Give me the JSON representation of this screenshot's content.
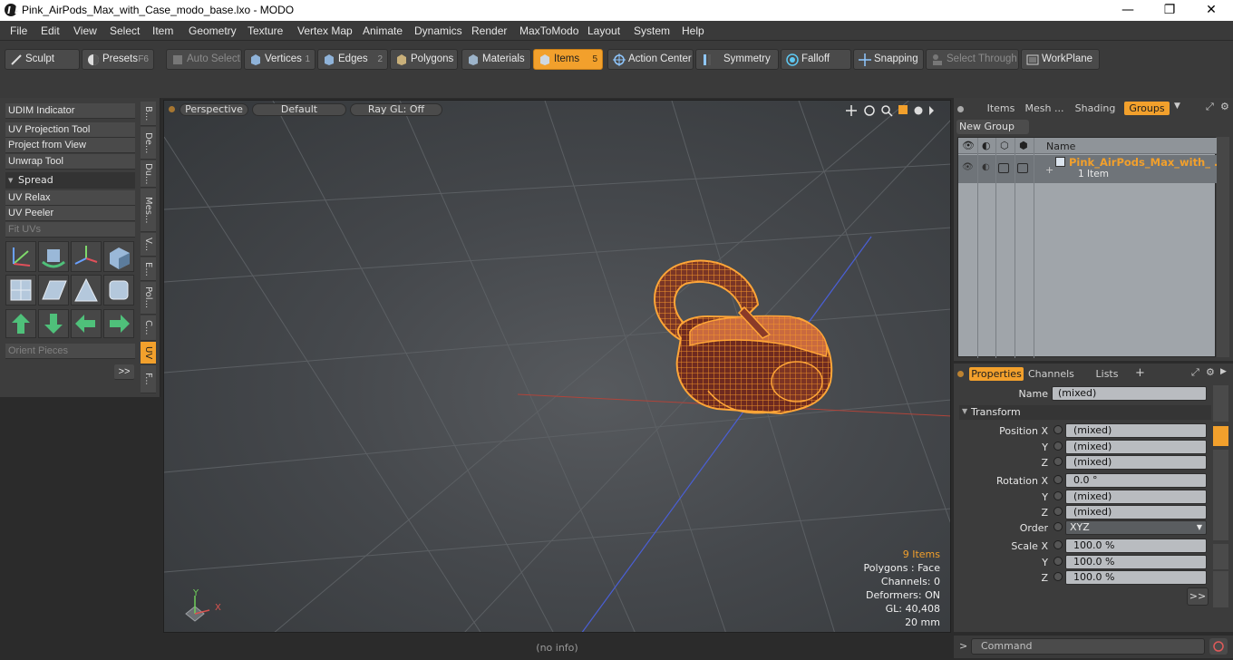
{
  "window": {
    "title": "Pink_AirPods_Max_with_Case_modo_base.lxo - MODO",
    "minimize": "—",
    "maximize": "❐",
    "close": "✕"
  },
  "menu": [
    "File",
    "Edit",
    "View",
    "Select",
    "Item",
    "Geometry",
    "Texture",
    "Vertex Map",
    "Animate",
    "Dynamics",
    "Render",
    "MaxToModo",
    "Layout",
    "System",
    "Help"
  ],
  "toolbar": {
    "sculpt": "Sculpt",
    "presets": "Presets",
    "presets_key": "F6",
    "auto_select": "Auto Select",
    "vertices": "Vertices",
    "vertices_key": "1",
    "edges": "Edges",
    "edges_key": "2",
    "polygons": "Polygons",
    "materials": "Materials",
    "items": "Items",
    "items_key": "5",
    "action_center": "Action Center",
    "symmetry": "Symmetry",
    "falloff": "Falloff",
    "snapping": "Snapping",
    "select_through": "Select Through",
    "workplane": "WorkPlane"
  },
  "left_panel": {
    "udim": "UDIM Indicator",
    "uv_projection": "UV Projection Tool",
    "project_from_view": "Project from View",
    "unwrap": "Unwrap Tool",
    "spread": "Spread",
    "uv_relax": "UV Relax",
    "uv_peeler": "UV Peeler",
    "fit_uvs": "Fit UVs",
    "orient_pieces": "Orient Pieces",
    "more": ">>",
    "vtabs": [
      "B...",
      "De...",
      "Du...",
      "Mes...",
      "V...",
      "E...",
      "Pol...",
      "C...",
      "UV",
      "F..."
    ]
  },
  "viewport": {
    "perspective": "Perspective",
    "default": "Default",
    "raygl": "Ray GL: Off",
    "stats": {
      "items": "9 Items",
      "polygons": "Polygons : Face",
      "channels": "Channels: 0",
      "deformers": "Deformers: ON",
      "gl": "GL: 40,408",
      "size": "20 mm"
    },
    "axis_y": "Y",
    "axis_x": "X"
  },
  "status": "(no info)",
  "right_top": {
    "tabs": [
      "Items",
      "Mesh ...",
      "Shading",
      "Groups"
    ],
    "new_group": "New Group",
    "col_name": "Name",
    "group_name": "Pink_AirPods_Max_with_ ...",
    "group_count": "1 Item"
  },
  "properties": {
    "tabs": [
      "Properties",
      "Channels",
      "Lists"
    ],
    "name_label": "Name",
    "name_value": "(mixed)",
    "transform": "Transform",
    "pos_x_label": "Position X",
    "pos_x": "(mixed)",
    "pos_y": "(mixed)",
    "pos_z": "(mixed)",
    "rot_x_label": "Rotation X",
    "rot_x": "0.0 °",
    "rot_y": "(mixed)",
    "rot_z": "(mixed)",
    "order_label": "Order",
    "order": "XYZ",
    "scale_x_label": "Scale X",
    "scale_x": "100.0 %",
    "scale_y": "100.0 %",
    "scale_z": "100.0 %",
    "y": "Y",
    "z": "Z",
    "more": ">>"
  },
  "command": {
    "prompt": ">",
    "placeholder": "Command"
  },
  "colors": {
    "accent": "#f2a02c",
    "wire": "#f29a2a"
  }
}
